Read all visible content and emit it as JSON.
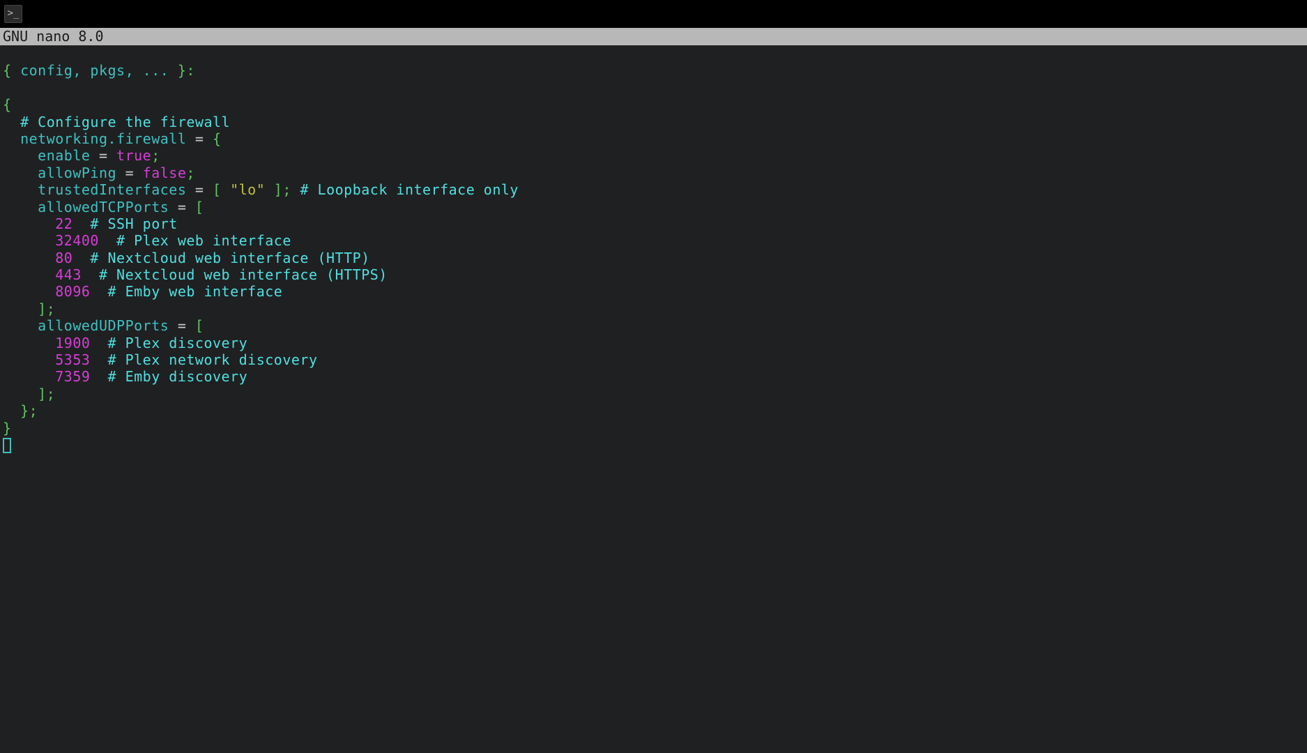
{
  "titlebar": {
    "icon_glyph": ">_"
  },
  "nano": {
    "header": "  GNU nano 8.0"
  },
  "code": {
    "l1_open": "{",
    "l1_args": " config, pkgs, ... ",
    "l1_close": "}:",
    "l3_open": "{",
    "l4_comment": "  # Configure the firewall",
    "l5_key": "  networking.firewall ",
    "l5_eq": "= ",
    "l5_brace": "{",
    "l6_key": "    enable ",
    "l6_eq": "= ",
    "l6_val": "true",
    "l6_semi": ";",
    "l7_key": "    allowPing ",
    "l7_eq": "= ",
    "l7_val": "false",
    "l7_semi": ";",
    "l8_key": "    trustedInterfaces ",
    "l8_eq": "= ",
    "l8_lb": "[ ",
    "l8_str": "\"lo\"",
    "l8_rb": " ]",
    "l8_semi": ";",
    "l8_comment": " # Loopback interface only",
    "l9_key": "    allowedTCPPorts ",
    "l9_eq": "= ",
    "l9_lb": "[",
    "l10_num": "      22",
    "l10_comment": "  # SSH port",
    "l11_num": "      32400",
    "l11_comment": "  # Plex web interface",
    "l12_num": "      80",
    "l12_comment": "  # Nextcloud web interface (HTTP)",
    "l13_num": "      443",
    "l13_comment": "  # Nextcloud web interface (HTTPS)",
    "l14_num": "      8096",
    "l14_comment": "  # Emby web interface",
    "l15_rb": "    ]",
    "l15_semi": ";",
    "l16_key": "    allowedUDPPorts ",
    "l16_eq": "= ",
    "l16_lb": "[",
    "l17_num": "      1900",
    "l17_comment": "  # Plex discovery",
    "l18_num": "      5353",
    "l18_comment": "  # Plex network discovery",
    "l19_num": "      7359",
    "l19_comment": "  # Emby discovery",
    "l20_rb": "    ]",
    "l20_semi": ";",
    "l21_brace": "  }",
    "l21_semi": ";",
    "l22_brace": "}"
  }
}
